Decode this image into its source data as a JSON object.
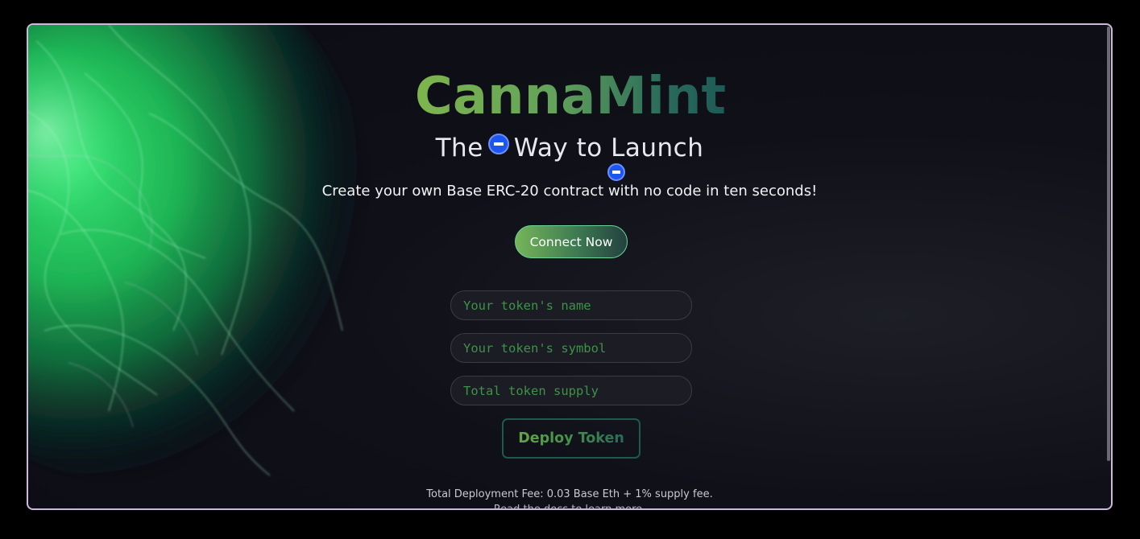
{
  "app": {
    "title": "CannaMint"
  },
  "hero": {
    "subtitle_before": "The",
    "subtitle_after": "Way to Launch",
    "coin_icon": "base-coin-icon",
    "tagline": "Create your own Base ERC-20 contract with no code in ten seconds!"
  },
  "actions": {
    "connect_label": "Connect Now",
    "deploy_label": "Deploy Token"
  },
  "form": {
    "name_placeholder": "Your token's name",
    "symbol_placeholder": "Your token's symbol",
    "supply_placeholder": "Total token supply"
  },
  "footer": {
    "fee_text": "Total Deployment Fee: 0.03 Base Eth + 1% supply fee.",
    "docs_text": "Read the docs to learn more."
  },
  "colors": {
    "background": "#0f0f17",
    "accent_green": "#6db150",
    "accent_teal": "#1e5a58",
    "base_blue": "#1d55f0",
    "frame_border": "#cdb9de",
    "placeholder_green": "#3d9347"
  }
}
